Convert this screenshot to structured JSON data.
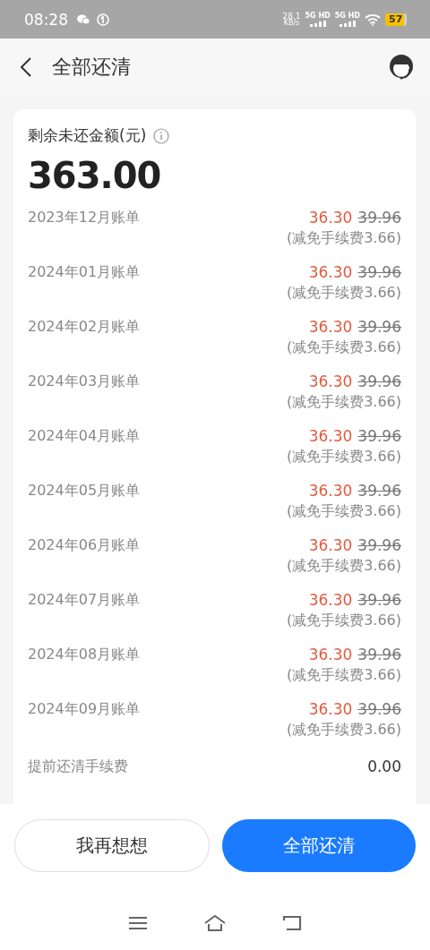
{
  "status_bar": {
    "time": "08:28",
    "speed": "28.1",
    "speed_unit": "KB/s",
    "sim1": "5G HD",
    "sim2": "5G HD",
    "battery": "57"
  },
  "header": {
    "title": "全部还清"
  },
  "summary": {
    "label": "剩余未还金额(元)",
    "amount": "363.00"
  },
  "bills": [
    {
      "period": "2023年12月账单",
      "amount": "36.30",
      "original": "39.96",
      "note": "(减免手续费3.66)"
    },
    {
      "period": "2024年01月账单",
      "amount": "36.30",
      "original": "39.96",
      "note": "(减免手续费3.66)"
    },
    {
      "period": "2024年02月账单",
      "amount": "36.30",
      "original": "39.96",
      "note": "(减免手续费3.66)"
    },
    {
      "period": "2024年03月账单",
      "amount": "36.30",
      "original": "39.96",
      "note": "(减免手续费3.66)"
    },
    {
      "period": "2024年04月账单",
      "amount": "36.30",
      "original": "39.96",
      "note": "(减免手续费3.66)"
    },
    {
      "period": "2024年05月账单",
      "amount": "36.30",
      "original": "39.96",
      "note": "(减免手续费3.66)"
    },
    {
      "period": "2024年06月账单",
      "amount": "36.30",
      "original": "39.96",
      "note": "(减免手续费3.66)"
    },
    {
      "period": "2024年07月账单",
      "amount": "36.30",
      "original": "39.96",
      "note": "(减免手续费3.66)"
    },
    {
      "period": "2024年08月账单",
      "amount": "36.30",
      "original": "39.96",
      "note": "(减免手续费3.66)"
    },
    {
      "period": "2024年09月账单",
      "amount": "36.30",
      "original": "39.96",
      "note": "(减免手续费3.66)"
    }
  ],
  "fee": {
    "label": "提前还清手续费",
    "value": "0.00"
  },
  "buttons": [
    {
      "label": "我再想想",
      "kind": "secondary"
    },
    {
      "label": "全部还清",
      "kind": "primary"
    }
  ]
}
